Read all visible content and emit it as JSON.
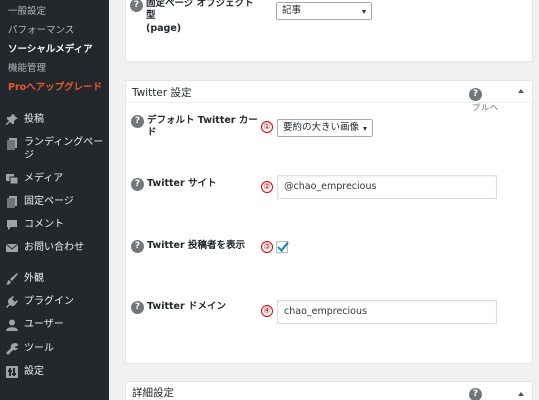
{
  "sidebar": {
    "submenu": [
      {
        "label": "一般設定"
      },
      {
        "label": "パフォーマンス"
      },
      {
        "label": "ソーシャルメディア"
      },
      {
        "label": "機能管理"
      },
      {
        "label": "Proへアップグレード"
      }
    ],
    "menu": [
      {
        "label": "投稿",
        "icon": "pin-icon"
      },
      {
        "label": "ランディングペー\nジ",
        "icon": "pages-icon"
      },
      {
        "label": "メディア",
        "icon": "media-icon"
      },
      {
        "label": "固定ページ",
        "icon": "page-icon"
      },
      {
        "label": "コメント",
        "icon": "comment-icon"
      },
      {
        "label": "お問い合わせ",
        "icon": "mail-icon"
      },
      {
        "label": "外観",
        "icon": "brush-icon"
      },
      {
        "label": "プラグイン",
        "icon": "plugin-icon"
      },
      {
        "label": "ユーザー",
        "icon": "user-icon"
      },
      {
        "label": "ツール",
        "icon": "wrench-icon"
      },
      {
        "label": "設定",
        "icon": "settings-icon"
      }
    ]
  },
  "top_panel": {
    "label_line1": "固定ページ オブジェクト",
    "label_line2": "型",
    "label_line3": "(page)",
    "select_value": "記事"
  },
  "twitter_panel": {
    "title": "Twitter 設定",
    "help_label": "ヘルプ",
    "fields": [
      {
        "label": "デフォルト Twitter カー\nド",
        "marker": "①",
        "value": "要約の大きい画像"
      },
      {
        "label": "Twitter サイト",
        "marker": "②",
        "value": "@chao_emprecious"
      },
      {
        "label": "Twitter 投稿者を表示",
        "marker": "③",
        "checked": true
      },
      {
        "label": "Twitter ドメイン",
        "marker": "④",
        "value": "chao_emprecious"
      }
    ]
  },
  "detail_panel": {
    "title": "詳細設定"
  },
  "colors": {
    "sidebar_bg": "#23282d",
    "pro_accent": "#f05a28",
    "marker_red": "#e00000",
    "checkbox_blue": "#1e8cbe"
  }
}
